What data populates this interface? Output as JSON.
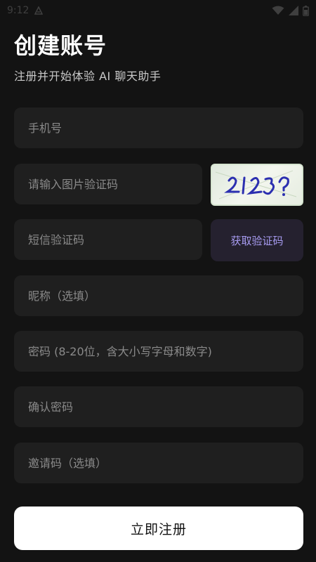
{
  "status_bar": {
    "time": "9:12",
    "icons": [
      "notification-icon",
      "wifi-icon",
      "cellular-icon",
      "battery-icon"
    ]
  },
  "header": {
    "title": "创建账号",
    "subtitle": "注册并开始体验 AI 聊天助手"
  },
  "form": {
    "phone": {
      "placeholder": "手机号",
      "value": ""
    },
    "image_captcha": {
      "placeholder": "请输入图片验证码",
      "value": ""
    },
    "captcha_image": {
      "alt": "2123?"
    },
    "sms_code": {
      "placeholder": "短信验证码",
      "value": ""
    },
    "sms_button_label": "获取验证码",
    "nickname": {
      "placeholder": "昵称（选填）",
      "value": ""
    },
    "password": {
      "placeholder": "密码 (8-20位，含大小写字母和数字)",
      "value": ""
    },
    "confirm_password": {
      "placeholder": "确认密码",
      "value": ""
    },
    "invite_code": {
      "placeholder": "邀请码（选填）",
      "value": ""
    },
    "submit_label": "立即注册"
  },
  "colors": {
    "background": "#131313",
    "field_bg": "#1f1f1f",
    "accent": "#a79bf0",
    "sms_button_bg": "#25212f",
    "submit_bg": "#ffffff"
  }
}
